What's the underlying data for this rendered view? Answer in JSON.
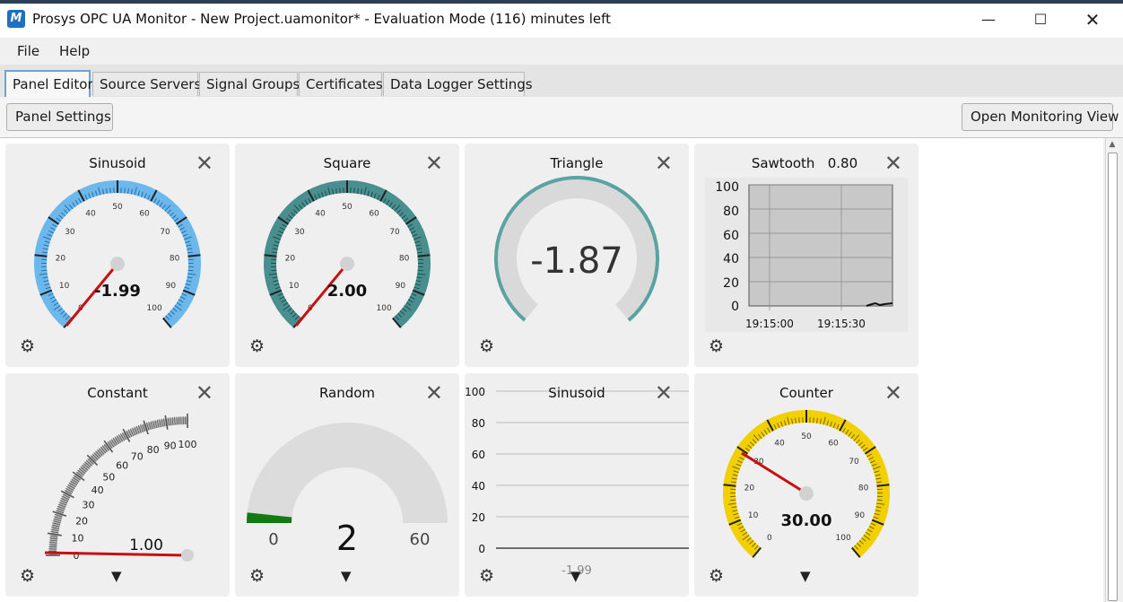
{
  "window": {
    "title": "Prosys OPC UA Monitor - New Project.uamonitor* - Evaluation Mode (116) minutes left",
    "icon_letter": "M",
    "controls": [
      "minimize-icon",
      "maximize-icon",
      "close-icon"
    ]
  },
  "menu": {
    "file": "File",
    "help": "Help"
  },
  "tabs": [
    "Panel Editor",
    "Source Servers",
    "Signal Groups",
    "Certificates",
    "Data Logger Settings"
  ],
  "toolbar": {
    "panel_settings": "Panel Settings",
    "open_monitoring_view": "Open Monitoring View"
  },
  "colors": {
    "blue_gauge": "#6cb8ec",
    "teal_gauge": "#4a8f8f",
    "needle": "#c81010",
    "yellow_gauge": "#f2d000",
    "green_bar": "#137a13",
    "arc_teal": "#5aa3a3"
  },
  "panels": [
    {
      "title": "Sinusoid",
      "type": "radial-gauge",
      "value": "-1.99",
      "min": 0,
      "max": 100,
      "ticks": [
        "0",
        "10",
        "20",
        "30",
        "40",
        "50",
        "60",
        "70",
        "80",
        "90",
        "100"
      ]
    },
    {
      "title": "Square",
      "type": "radial-gauge",
      "value": "2.00",
      "min": 0,
      "max": 100,
      "ticks": [
        "0",
        "10",
        "20",
        "30",
        "40",
        "50",
        "60",
        "70",
        "80",
        "90",
        "100"
      ]
    },
    {
      "title": "Triangle",
      "type": "donut-gauge",
      "value": "-1.87"
    },
    {
      "title": "Sawtooth",
      "value": "0.80",
      "type": "trend",
      "y_ticks": [
        "100",
        "80",
        "60",
        "40",
        "20",
        "0"
      ],
      "x_ticks": [
        "19:15:00",
        "19:15:30"
      ]
    },
    {
      "title": "Constant",
      "type": "quarter-gauge",
      "value": "1.00",
      "ticks": [
        "0",
        "10",
        "20",
        "30",
        "40",
        "50",
        "60",
        "70",
        "80",
        "90",
        "100"
      ]
    },
    {
      "title": "Random",
      "type": "semi-gauge",
      "value": "2",
      "min": "0",
      "max": "60"
    },
    {
      "title": "Sinusoid",
      "type": "line-chart",
      "value": "-1.99",
      "y_ticks": [
        "100",
        "80",
        "60",
        "40",
        "20",
        "0"
      ]
    },
    {
      "title": "Counter",
      "type": "radial-gauge",
      "value": "30.00",
      "min": 0,
      "max": 100,
      "ticks": [
        "0",
        "10",
        "20",
        "30",
        "40",
        "50",
        "60",
        "70",
        "80",
        "90",
        "100"
      ]
    }
  ]
}
